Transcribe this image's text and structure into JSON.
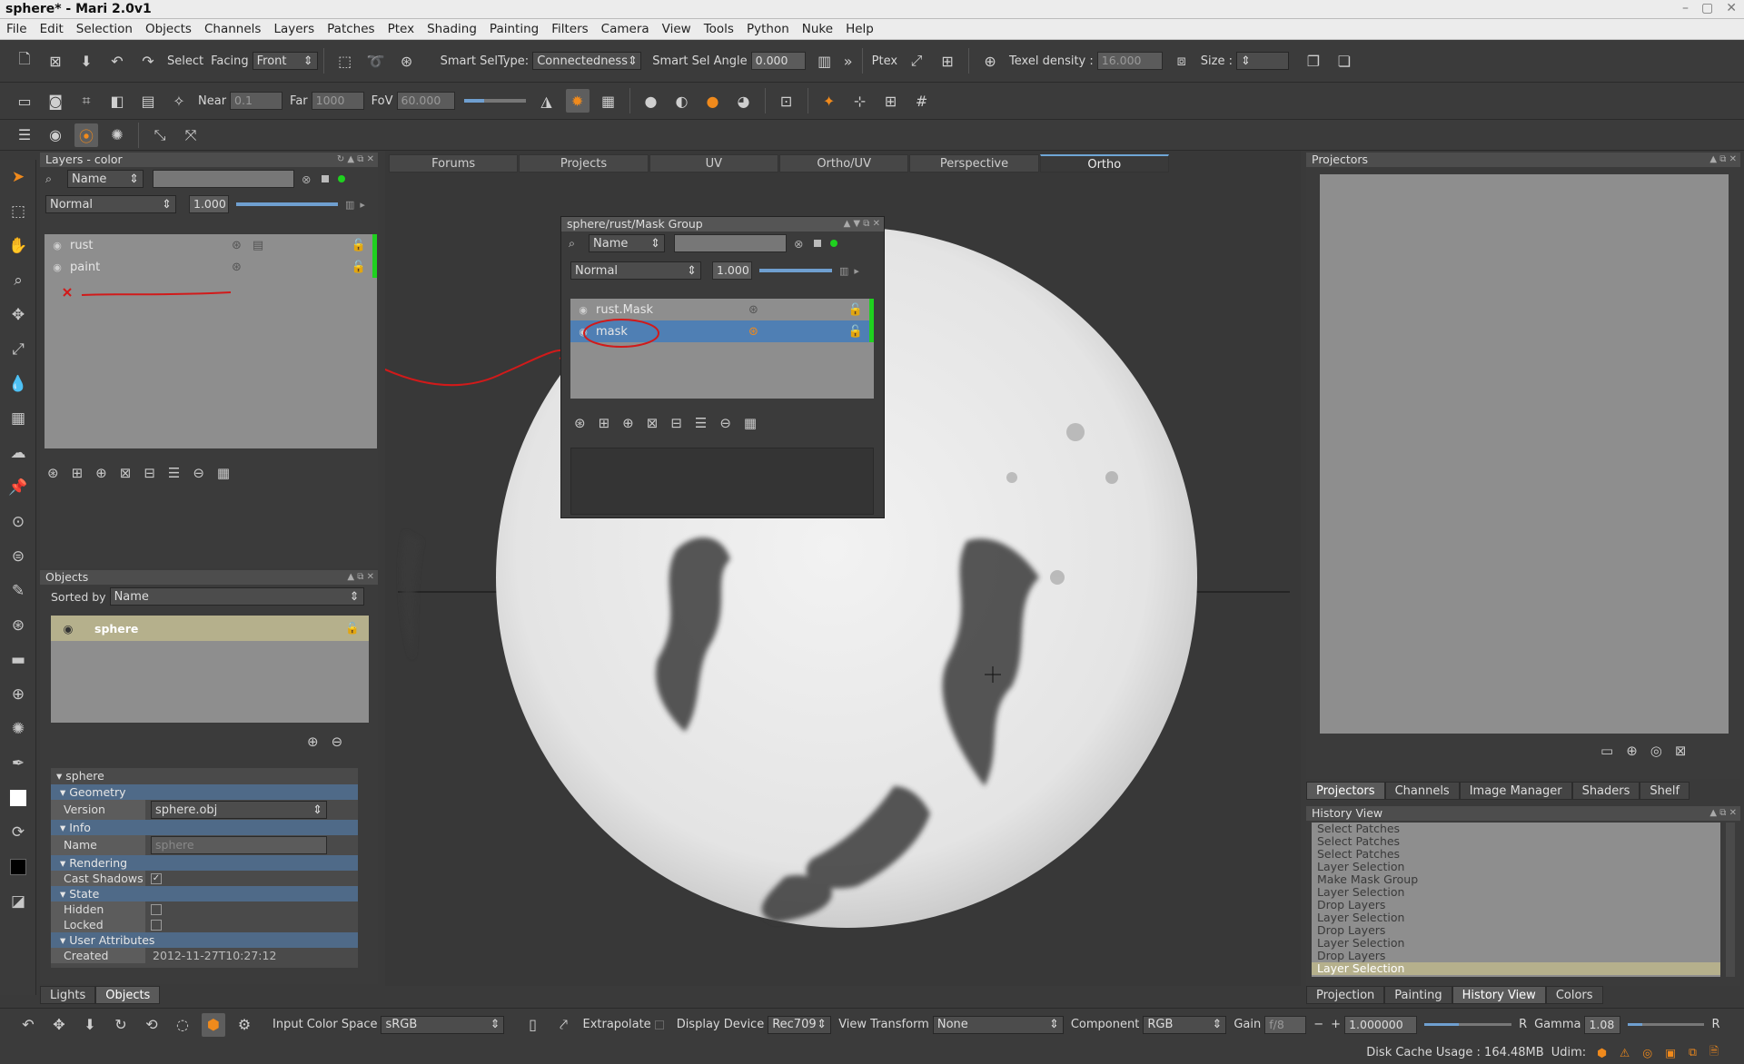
{
  "window": {
    "title": "sphere* - Mari 2.0v1"
  },
  "menu": [
    "File",
    "Edit",
    "Selection",
    "Objects",
    "Channels",
    "Layers",
    "Patches",
    "Ptex",
    "Shading",
    "Painting",
    "Filters",
    "Camera",
    "View",
    "Tools",
    "Python",
    "Nuke",
    "Help"
  ],
  "toolbar1": {
    "select": "Select",
    "facing": "Facing",
    "facing_value": "Front",
    "smart_sel_type": "Smart SelType:",
    "smart_sel_type_value": "Connectedness",
    "smart_sel_angle": "Smart Sel Angle",
    "smart_sel_angle_value": "0.000",
    "ptex": "Ptex",
    "texel_density": "Texel density :",
    "texel_density_value": "16.000",
    "size": "Size :"
  },
  "toolbar2": {
    "near": "Near",
    "near_value": "0.1",
    "far": "Far",
    "far_value": "1000",
    "fov": "FoV",
    "fov_value": "60.000"
  },
  "layers_panel": {
    "title": "Layers - color",
    "search_by": "Name",
    "blend": "Normal",
    "opacity": "1.000",
    "layers": [
      {
        "name": "rust"
      },
      {
        "name": "paint"
      }
    ]
  },
  "view_tabs": [
    "Forums",
    "Projects",
    "UV",
    "Ortho/UV",
    "Perspective",
    "Ortho"
  ],
  "mask_panel": {
    "title": "sphere/rust/Mask Group",
    "search_by": "Name",
    "blend": "Normal",
    "opacity": "1.000",
    "layers": [
      {
        "name": "rust.Mask"
      },
      {
        "name": "mask"
      }
    ]
  },
  "objects_panel": {
    "title": "Objects",
    "sorted_by_label": "Sorted by",
    "sorted_by_value": "Name",
    "objects": [
      {
        "name": "sphere"
      }
    ]
  },
  "properties": {
    "object": "sphere",
    "geometry": "Geometry",
    "version_label": "Version",
    "version_value": "sphere.obj",
    "info": "Info",
    "name_label": "Name",
    "name_value": "sphere",
    "rendering": "Rendering",
    "cast_shadows": "Cast Shadows",
    "state": "State",
    "hidden": "Hidden",
    "locked": "Locked",
    "user_attributes": "User Attributes",
    "created_label": "Created",
    "created_value": "2012-11-27T10:27:12"
  },
  "left_bottom_tabs": [
    "Lights",
    "Objects"
  ],
  "projectors_panel": {
    "title": "Projectors"
  },
  "right_tabs": [
    "Projectors",
    "Channels",
    "Image Manager",
    "Shaders",
    "Shelf"
  ],
  "history": {
    "title": "History View",
    "items": [
      "Select Patches",
      "Select Patches",
      "Select Patches",
      "Layer Selection",
      "Make Mask Group",
      "Layer Selection",
      "Drop Layers",
      "Layer Selection",
      "Drop Layers",
      "Layer Selection",
      "Drop Layers",
      "Layer Selection"
    ]
  },
  "right_bottom_tabs": [
    "Projection",
    "Painting",
    "History View",
    "Colors"
  ],
  "statusbar": {
    "input_color_space": "Input Color Space",
    "input_color_space_value": "sRGB",
    "extrapolate": "Extrapolate",
    "display_device": "Display Device",
    "display_device_value": "Rec709",
    "view_transform": "View Transform",
    "view_transform_value": "None",
    "component": "Component",
    "component_value": "RGB",
    "gain": "Gain",
    "gain_value": "f/8",
    "gain_number": "1.000000",
    "gain_channel": "R",
    "gamma": "Gamma",
    "gamma_value": "1.08",
    "gamma_channel": "R",
    "disk_cache": "Disk Cache Usage : 164.48MB",
    "udim": "Udim:"
  },
  "colors": {
    "accent": "#f08a1c",
    "selection": "#4f7fb4",
    "green": "#1fd11f",
    "annotation": "#d11a1a"
  }
}
